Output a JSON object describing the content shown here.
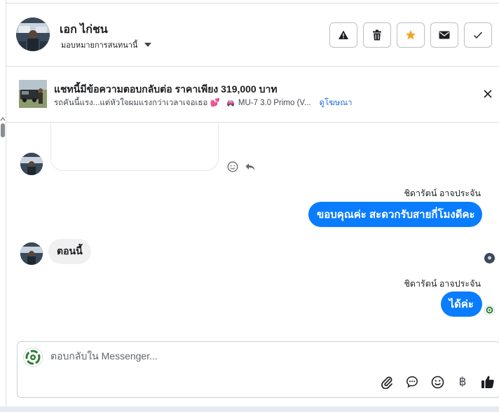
{
  "header": {
    "contact_name": "เอก ไก่ชน",
    "assign_label": "มอบหมายการสนทนานี้",
    "actions": [
      {
        "icon": "warning-icon"
      },
      {
        "icon": "trash-icon"
      },
      {
        "icon": "star-icon"
      },
      {
        "icon": "envelope-icon"
      },
      {
        "icon": "check-icon"
      }
    ]
  },
  "ad_banner": {
    "title": "แชทนี้มีข้อความตอบกลับต่อ ราคาเพียง 319,000 บาท",
    "subtitle": "รถคันนี้แรง...แต่หัวใจผมแรงกว่าเวลาเจอเธอ 💕",
    "car_label": "MU-7 3.0 Primo (V...",
    "link": "ดูโฆษณา"
  },
  "messages": [
    {
      "sender": "ชิดารัตน์ อาจประจัน",
      "text": "ขอบคุณค่ะ สะดวกรับสายกี่โมงดีคะ",
      "direction": "out"
    },
    {
      "text": "ตอนนี้",
      "direction": "in"
    },
    {
      "sender": "ชิดารัตน์ อาจประจัน",
      "text": "ได้ค่ะ",
      "direction": "out"
    }
  ],
  "composer": {
    "placeholder": "ตอบกลับใน Messenger...",
    "tools": [
      "paperclip-icon",
      "chat-icon",
      "emoji-icon",
      "baht-icon",
      "thumbs-up-icon"
    ],
    "baht_symbol": "฿"
  },
  "colors": {
    "accent": "#0a7cff",
    "link": "#216fdb",
    "star": "#f5a623"
  }
}
